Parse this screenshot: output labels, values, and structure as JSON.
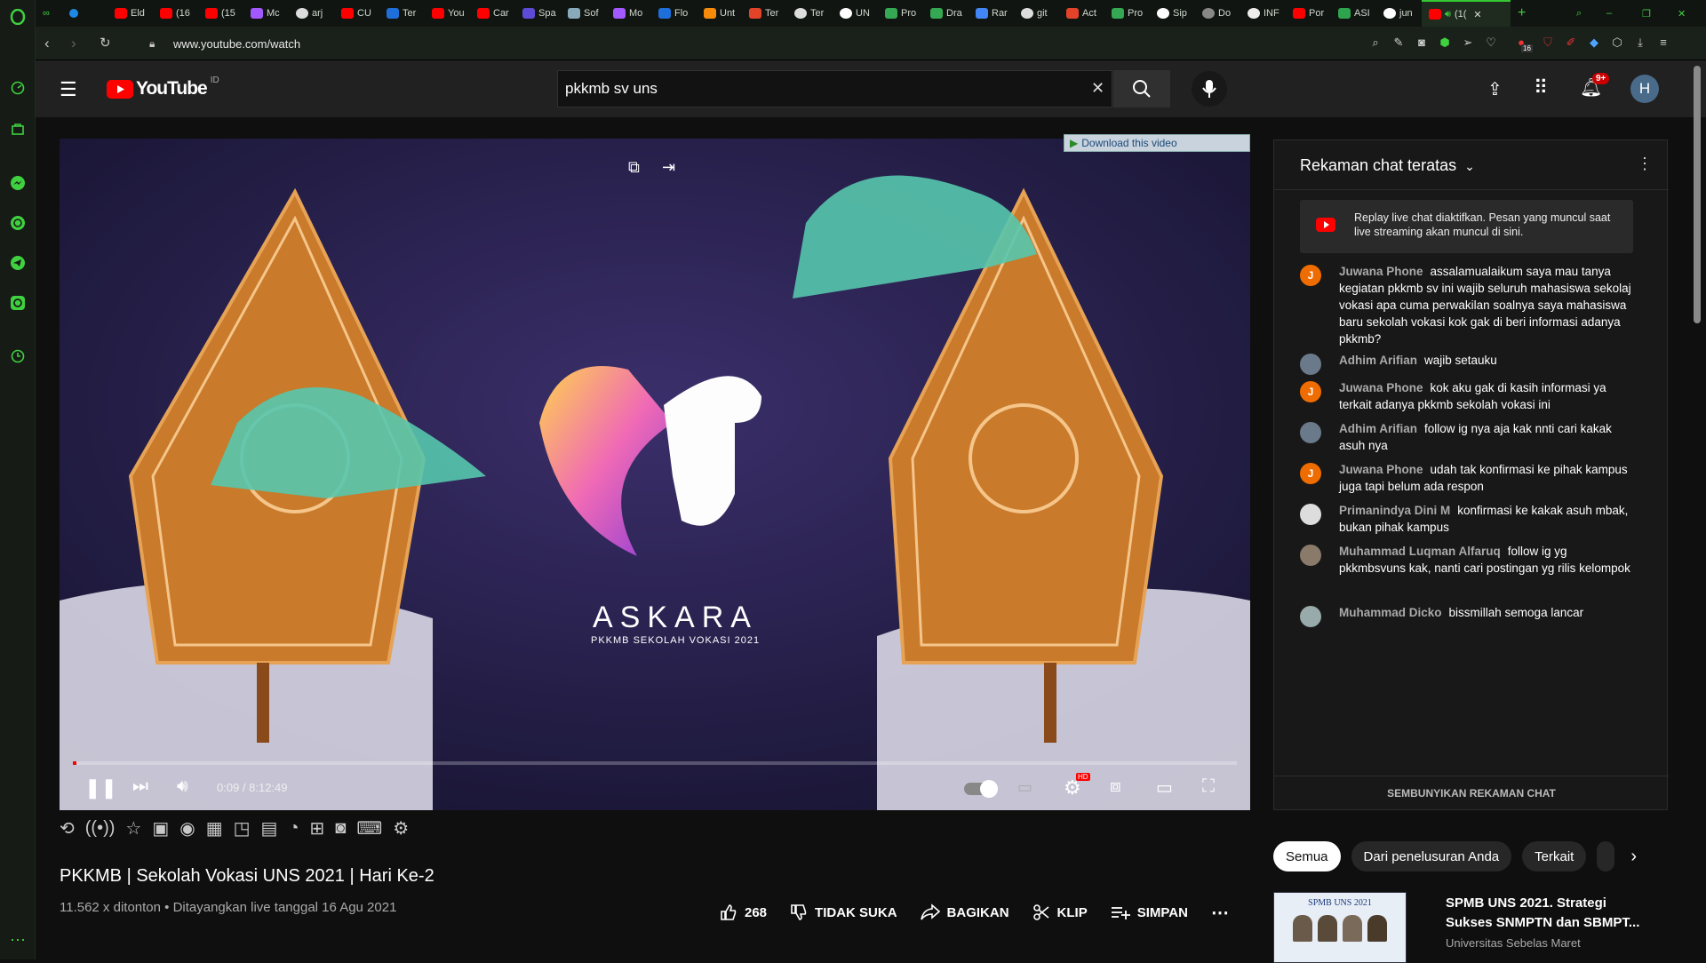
{
  "browser": {
    "tabs": [
      "Eld",
      "(16",
      "(15",
      "Mc",
      "arj",
      "CU",
      "Ter",
      "You",
      "Car",
      "Spa",
      "Sof",
      "Mo",
      "Flo",
      "Unt",
      "Ter",
      "Ter",
      "UN",
      "Pro",
      "Dra",
      "Rar",
      "git",
      "Act",
      "Pro",
      "Sip",
      "Do",
      "INF",
      "Por",
      "ASI",
      "jun",
      "(1("
    ],
    "url": "www.youtube.com/watch",
    "notification_count": "16"
  },
  "header": {
    "logo": "YouTube",
    "region": "ID",
    "search_value": "pkkmb sv uns",
    "notification_badge": "9+",
    "avatar_letter": "H"
  },
  "player": {
    "download_label": "Download this video",
    "logo_title": "ASKARA",
    "logo_subtitle": "PKKMB SEKOLAH VOKASI 2021",
    "time_display": "0:09 / 8:12:49",
    "progress_fraction": 0.0003,
    "hd_badge": "HD"
  },
  "video": {
    "title": "PKKMB | Sekolah Vokasi UNS 2021 | Hari Ke-2",
    "meta": "11.562 x ditonton • Ditayangkan live tanggal 16 Agu 2021",
    "likes": "268",
    "dislike_label": "TIDAK SUKA",
    "share_label": "BAGIKAN",
    "clip_label": "KLIP",
    "save_label": "SIMPAN"
  },
  "chat": {
    "title": "Rekaman chat teratas",
    "notice": "Replay live chat diaktifkan. Pesan yang muncul saat live streaming akan muncul di sini.",
    "messages": [
      {
        "author": "Juwana Phone",
        "text": "assalamualaikum saya mau tanya kegiatan pkkmb sv ini wajib seluruh mahasiswa sekolaj vokasi apa cuma perwakilan soalnya saya mahasiswa baru sekolah vokasi kok gak di beri informasi adanya pkkmb?",
        "avatar": "J"
      },
      {
        "author": "Adhim Arifian",
        "text": "wajib setauku",
        "avatar": ""
      },
      {
        "author": "Juwana Phone",
        "text": "kok aku gak di kasih informasi ya terkait adanya pkkmb sekolah vokasi ini",
        "avatar": "J"
      },
      {
        "author": "Adhim Arifian",
        "text": "follow ig nya aja kak nnti cari kakak asuh nya",
        "avatar": ""
      },
      {
        "author": "Juwana Phone",
        "text": "udah tak konfirmasi ke pihak kampus juga tapi belum ada respon",
        "avatar": "J"
      },
      {
        "author": "Primanindya Dini M",
        "text": "konfirmasi ke kakak asuh mbak, bukan pihak kampus",
        "avatar": ""
      },
      {
        "author": "Muhammad Luqman Alfaruq",
        "text": "follow ig yg pkkmbsvuns kak, nanti cari postingan yg rilis kelompok",
        "avatar": ""
      },
      {
        "author": "Muhammad Dicko",
        "text": "bissmillah semoga lancar",
        "avatar": ""
      }
    ],
    "hide_label": "SEMBUNYIKAN REKAMAN CHAT"
  },
  "chips": [
    "Semua",
    "Dari penelusuran Anda",
    "Terkait"
  ],
  "recommendation": {
    "title": "SPMB UNS 2021. Strategi Sukses SNMPTN dan SBMPT...",
    "channel": "Universitas Sebelas Maret",
    "thumb_caption": "SPMB UNS 2021"
  },
  "colors": {
    "accent": "#ff0000",
    "opera_green": "#3fd13f",
    "avatar_orange": "#ef6c00"
  }
}
